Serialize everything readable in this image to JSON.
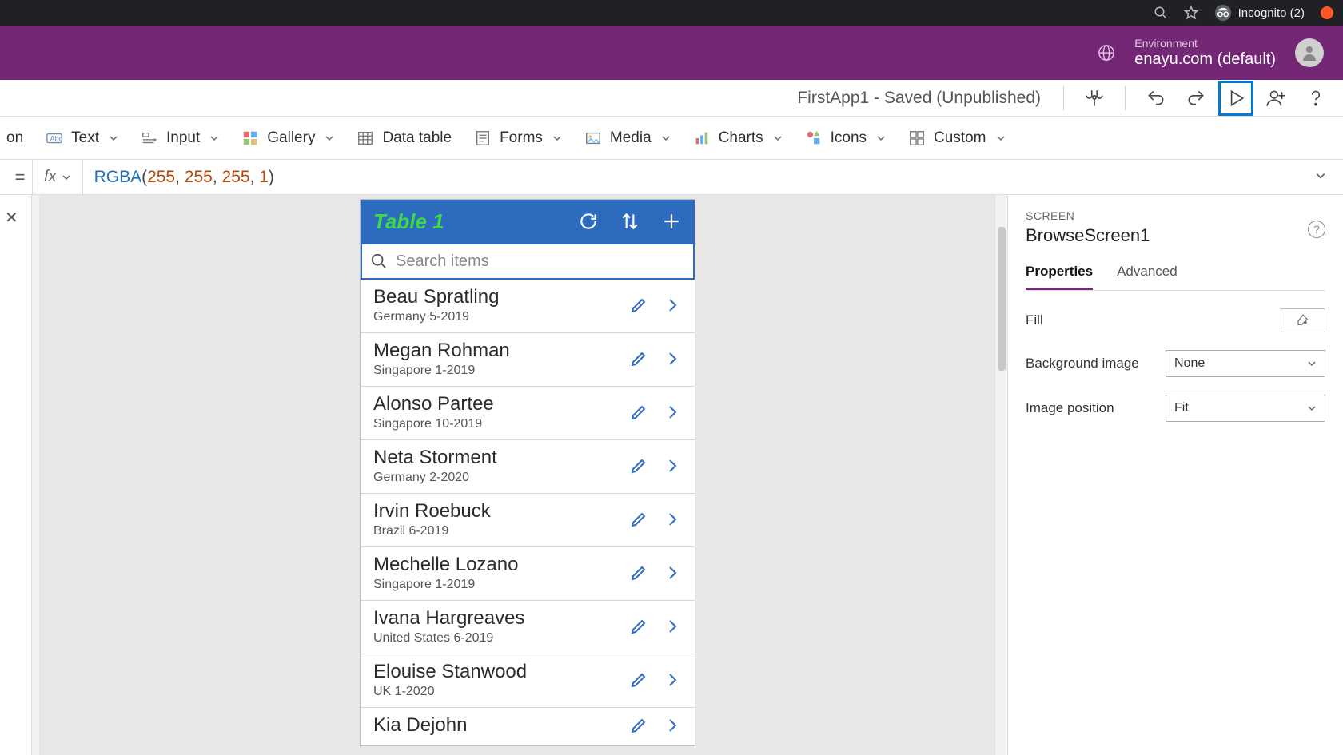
{
  "browser": {
    "incognito_label": "Incognito (2)"
  },
  "env": {
    "label": "Environment",
    "value": "enayu.com (default)"
  },
  "titlebar": {
    "status": "FirstApp1 - Saved (Unpublished)"
  },
  "ribbon": {
    "button_partial": "on",
    "text": "Text",
    "input": "Input",
    "gallery": "Gallery",
    "datatable": "Data table",
    "forms": "Forms",
    "media": "Media",
    "charts": "Charts",
    "icons": "Icons",
    "custom": "Custom"
  },
  "formula": {
    "fn": "RGBA",
    "args": [
      "255",
      "255",
      "255",
      "1"
    ]
  },
  "phone": {
    "title": "Table 1",
    "search_placeholder": "Search items",
    "items": [
      {
        "name": "Beau Spratling",
        "sub": "Germany 5-2019"
      },
      {
        "name": "Megan Rohman",
        "sub": "Singapore 1-2019"
      },
      {
        "name": "Alonso Partee",
        "sub": "Singapore 10-2019"
      },
      {
        "name": "Neta Storment",
        "sub": "Germany 2-2020"
      },
      {
        "name": "Irvin Roebuck",
        "sub": "Brazil 6-2019"
      },
      {
        "name": "Mechelle Lozano",
        "sub": "Singapore 1-2019"
      },
      {
        "name": "Ivana Hargreaves",
        "sub": "United States 6-2019"
      },
      {
        "name": "Elouise Stanwood",
        "sub": "UK 1-2020"
      },
      {
        "name": "Kia Dejohn",
        "sub": ""
      }
    ]
  },
  "props": {
    "section": "SCREEN",
    "name": "BrowseScreen1",
    "tab_properties": "Properties",
    "tab_advanced": "Advanced",
    "fill_label": "Fill",
    "bgimg_label": "Background image",
    "bgimg_value": "None",
    "imgpos_label": "Image position",
    "imgpos_value": "Fit"
  }
}
